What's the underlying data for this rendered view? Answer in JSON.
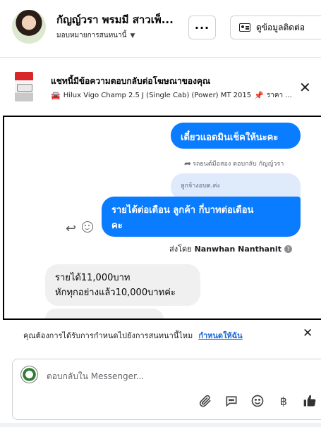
{
  "header": {
    "name": "กัญญ์วรา พรมมี สาวเพ็...",
    "assign_label": "มอบหมายการสนทนานี้",
    "more_label": "···",
    "contact_label": "ดูข้อมูลติดต่อ"
  },
  "ad": {
    "title": "แชทนี้มีข้อความตอบกลับต่อโฆษณาของคุณ",
    "subtitle": "Hilux Vigo Champ 2.5 J (Single Cab) (Power) MT 2015",
    "subtitle_tail": "ราคา ...",
    "close_label": "✕"
  },
  "messages": {
    "m1": "เดี๋ยวแอดมินเช็คให้นะคะ",
    "reply_note": "รถยนต์มือสอง ตอบกลับ กัญญ์วรา",
    "quoted": "ลูกจ้างอบต.ค่ะ",
    "m2": "รายได้ต่อเดือน  ลูกค้า   กี่บาทต่อเดือน\nคะ",
    "sent_by_prefix": "ส่งโดย",
    "sent_by_name": "Nanwhan Nanthanit",
    "m3": "รายได้11,000บาท\nหักทุกอย่างแล้ว10,000บาทค่ะ"
  },
  "followup": {
    "question": "คุณต้องการได้รับการกำหนดไปยังการสนทนานี้ไหม",
    "link": "กำหนดให้ฉัน",
    "close_label": "✕"
  },
  "composer": {
    "placeholder": "ตอบกลับใน Messenger..."
  },
  "colors": {
    "accent": "#0a7cff",
    "link": "#1a66d6",
    "incoming_bubble": "#f0f0f0"
  }
}
